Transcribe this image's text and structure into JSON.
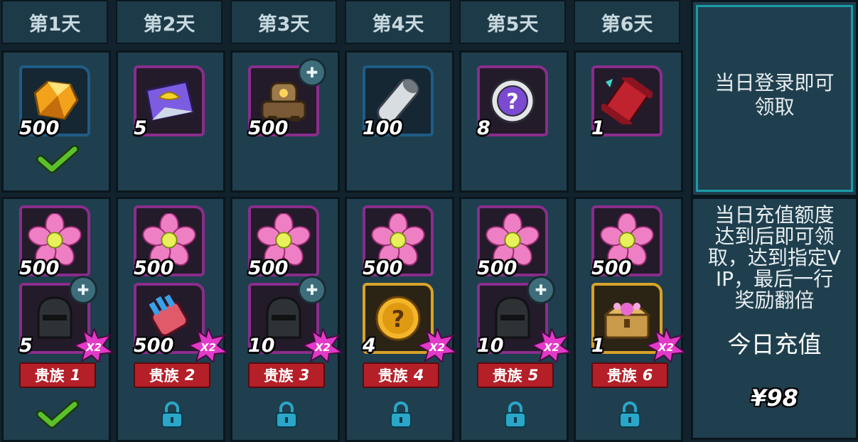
{
  "days": [
    {
      "label": "第1天"
    },
    {
      "label": "第2天"
    },
    {
      "label": "第3天"
    },
    {
      "label": "第4天"
    },
    {
      "label": "第5天"
    },
    {
      "label": "第6天"
    }
  ],
  "login_rewards": [
    {
      "item": "amber-crystal-icon",
      "qty": "500",
      "frame": "blue",
      "puzzle": false,
      "claimed": true
    },
    {
      "item": "wing-ticket-icon",
      "qty": "5",
      "frame": "purple",
      "puzzle": false,
      "claimed": false
    },
    {
      "item": "mech-robot-icon",
      "qty": "500",
      "frame": "purple",
      "puzzle": true,
      "claimed": false
    },
    {
      "item": "metal-cylinder-icon",
      "qty": "100",
      "frame": "blue",
      "puzzle": false,
      "claimed": false
    },
    {
      "item": "mystery-chip-icon",
      "qty": "8",
      "frame": "purple",
      "puzzle": false,
      "claimed": false
    },
    {
      "item": "red-scroll-icon",
      "qty": "1",
      "frame": "purple",
      "puzzle": false,
      "claimed": false
    }
  ],
  "recharge_rewards": [
    {
      "flower_qty": "500",
      "item": "knight-helmet-icon",
      "qty": "5",
      "frame": "purple",
      "puzzle": true,
      "noble": "贵族",
      "noble_num": "1",
      "status": "claimed"
    },
    {
      "flower_qty": "500",
      "item": "crystal-gauntlet-icon",
      "qty": "500",
      "frame": "purple",
      "puzzle": false,
      "noble": "贵族",
      "noble_num": "2",
      "status": "locked"
    },
    {
      "flower_qty": "500",
      "item": "knight-helmet-icon",
      "qty": "10",
      "frame": "purple",
      "puzzle": true,
      "noble": "贵族",
      "noble_num": "3",
      "status": "locked"
    },
    {
      "flower_qty": "500",
      "item": "gold-mystery-coin-icon",
      "qty": "4",
      "frame": "gold",
      "puzzle": false,
      "noble": "贵族",
      "noble_num": "4",
      "status": "locked"
    },
    {
      "flower_qty": "500",
      "item": "knight-helmet-icon",
      "qty": "10",
      "frame": "purple",
      "puzzle": true,
      "noble": "贵族",
      "noble_num": "5",
      "status": "locked"
    },
    {
      "flower_qty": "500",
      "item": "gold-treasure-chest-icon",
      "qty": "1",
      "frame": "gold",
      "puzzle": false,
      "noble": "贵族",
      "noble_num": "6",
      "status": "locked"
    }
  ],
  "double_badge": "X2",
  "side": {
    "login_desc_line1": "当日登录即可",
    "login_desc_line2": "领取",
    "recharge_desc_lines": [
      "当日充值额度",
      "达到后即可领",
      "取，达到指定V",
      "IP，最后一行",
      "奖励翻倍"
    ],
    "recharge_label": "今日充值",
    "recharge_amount": "¥98"
  },
  "colors": {
    "cell_bg": "#1f3f4e",
    "accent_teal": "#1c9aa8",
    "noble_red": "#b41f28",
    "check_green": "#5cc02b",
    "lock_blue": "#2aa6c8"
  }
}
